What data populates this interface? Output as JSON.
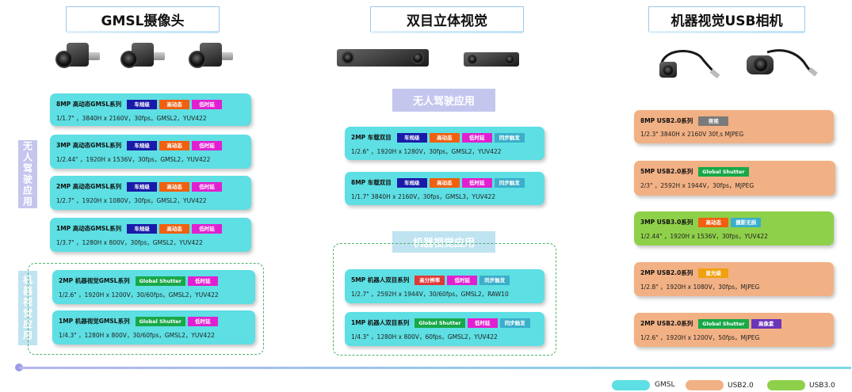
{
  "sections": {
    "gmsl": "GMSL摄像头",
    "stereo": "双目立体视觉",
    "usb": "机器视觉USB相机"
  },
  "sublabels": {
    "gmsl_auto": "无人驾驶应用",
    "gmsl_mv": "机器视觉应用",
    "stereo_auto": "无人驾驶应用",
    "stereo_mv": "机器视觉应用"
  },
  "colors": {
    "gmsl": "#5ddfe3",
    "usb2": "#f2b184",
    "usb3": "#8fd04a",
    "tag_auto": "#1a1aa8",
    "tag_hdr": "#f06010",
    "tag_lowlat": "#e020d0",
    "tag_sync": "#3aaeca",
    "tag_gs": "#18a848",
    "tag_night": "#7a7a7a",
    "tag_red": "#e03838",
    "tag_starlight": "#f0a010",
    "tag_hipixel": "#6a35b8"
  },
  "gmsl_auto": [
    {
      "name": "8MP 高动态GMSL系列",
      "tags": [
        "车规级",
        "高动态",
        "低时延"
      ],
      "spec": "1/1.7\" ，3840H x 2160V，30fps，GMSL2，YUV422"
    },
    {
      "name": "3MP 高动态GMSL系列",
      "tags": [
        "车规级",
        "高动态",
        "低时延"
      ],
      "spec": "1/2.44\" ，1920H x 1536V，30fps，GMSL2，YUV422"
    },
    {
      "name": "2MP 高动态GMSL系列",
      "tags": [
        "车规级",
        "高动态",
        "低时延"
      ],
      "spec": "1/2.7\" ，1920H x 1080V，30fps，GMSL2，YUV422"
    },
    {
      "name": "1MP 高动态GMSL系列",
      "tags": [
        "车规级",
        "高动态",
        "低时延"
      ],
      "spec": "1/3.7\" ，1280H x 800V，30fps，GMSL2，YUV422"
    }
  ],
  "gmsl_mv": [
    {
      "name": "2MP 机器视觉GMSL系列",
      "tags": [
        "Global Shutter",
        "低时延"
      ],
      "spec": "1/2.6\" ，1920H x 1200V，30/60fps，GMSL2，YUV422"
    },
    {
      "name": "1MP 机器视觉GMSL系列",
      "tags": [
        "Global Shutter",
        "低时延"
      ],
      "spec": "1/4.3\" ，1280H x 800V，30/60fps，GMSL2，YUV422"
    }
  ],
  "stereo_auto": [
    {
      "name": "2MP 车载双目",
      "tags": [
        "车规级",
        "高动态",
        "低时延",
        "同步触发"
      ],
      "spec": "1/2.6\" ，1920H x 1280V，30fps，GMSL2，YUV422"
    },
    {
      "name": "8MP 车载双目",
      "tags": [
        "车规级",
        "高动态",
        "低时延",
        "同步触发"
      ],
      "spec": "1/1.7\"  3840H x 2160V，30fps，GMSL3，YUV422"
    }
  ],
  "stereo_mv": [
    {
      "name": "5MP 机器人双目系列",
      "tags": [
        "高分辨率",
        "低时延",
        "同步触发"
      ],
      "spec": "1/2.7\" ，2592H x 1944V，30/60fps，GMSL2，RAW10"
    },
    {
      "name": "1MP 机器人双目系列",
      "tags": [
        "Global Shutter",
        "低时延",
        "同步触发"
      ],
      "spec": "1/4.3\" ，1280H x 800V，60fps，GMSL2，YUV422"
    }
  ],
  "usb": [
    {
      "name": "8MP USB2.0系列",
      "tags": [
        "夜视"
      ],
      "spec": "1/2.3\"   3840H x 2160V   30f,s   MJPEG",
      "kind": "usb2"
    },
    {
      "name": "5MP USB2.0系列",
      "tags": [
        "Global Shutter"
      ],
      "spec": "2/3\" ，2592H x 1944V，30fps，MJPEG",
      "kind": "usb2"
    },
    {
      "name": "3MP USB3.0系列",
      "tags": [
        "高动态",
        "摄影无损"
      ],
      "spec": "1/2.44\" ，1920H x 1536V，30fps，YUV422",
      "kind": "usb3"
    },
    {
      "name": "2MP USB2.0系列",
      "tags": [
        "星光级"
      ],
      "spec": "1/2.8\" ，1920H x 1080V，30fps，MJPEG",
      "kind": "usb2"
    },
    {
      "name": "2MP USB2.0系列",
      "tags": [
        "Global Shutter",
        "高像素"
      ],
      "spec": "1/2.6\" ，1920H x 1200V，50fps，MJPEG",
      "kind": "usb2"
    }
  ],
  "legend": {
    "gmsl": "GMSL",
    "usb2": "USB2.0",
    "usb3": "USB3.0"
  }
}
